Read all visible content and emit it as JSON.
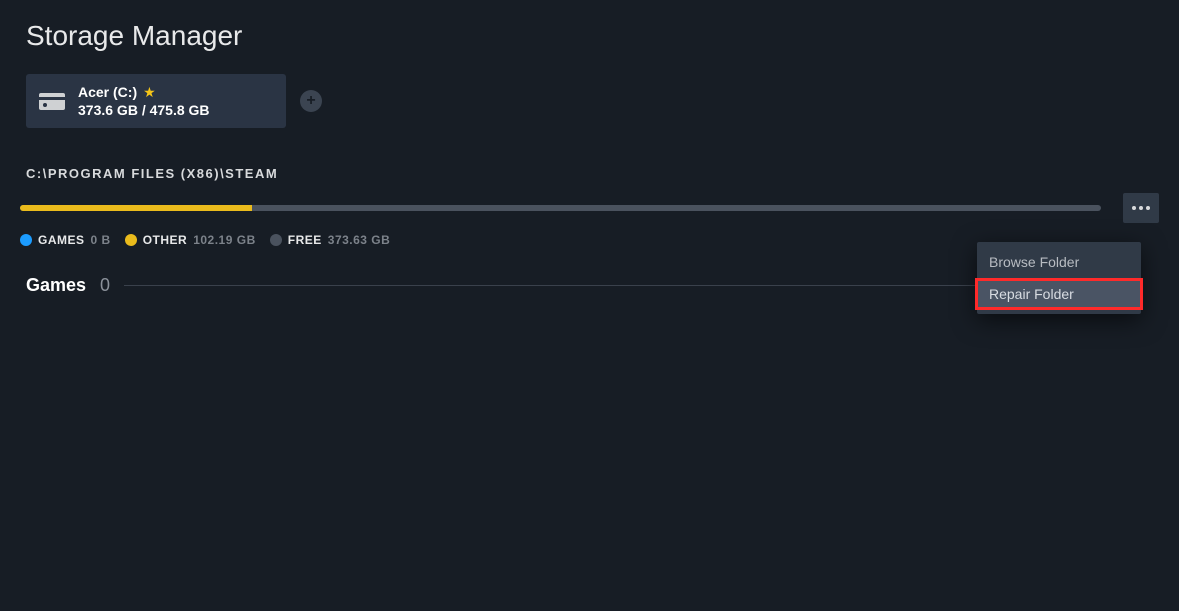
{
  "title": "Storage Manager",
  "drive": {
    "name": "Acer (C:)",
    "usage": "373.6 GB / 475.8 GB"
  },
  "path": "C:\\PROGRAM FILES (X86)\\STEAM",
  "usagePercent": {
    "games": 0,
    "other": 21.5
  },
  "legend": {
    "games": {
      "label": "GAMES",
      "value": "0 B"
    },
    "other": {
      "label": "OTHER",
      "value": "102.19 GB"
    },
    "free": {
      "label": "FREE",
      "value": "373.63 GB"
    }
  },
  "gamesSection": {
    "heading": "Games",
    "count": "0"
  },
  "menu": {
    "browse": "Browse Folder",
    "repair": "Repair Folder"
  }
}
